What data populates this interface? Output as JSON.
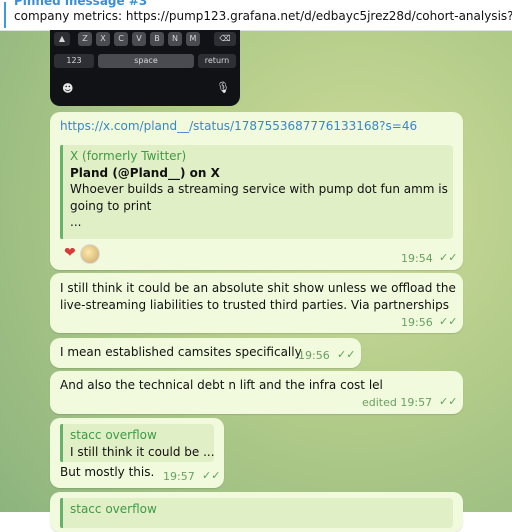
{
  "pinned": {
    "title": "Pinned message #3",
    "text": "company metrics: https://pump123.grafana.net/d/edbayc5jrez28d/cohort-analysis?orgId"
  },
  "keyboard": {
    "letters": [
      "Z",
      "X",
      "C",
      "V",
      "B",
      "N",
      "M"
    ],
    "numbers_label": "123",
    "space_label": "space",
    "return_label": "return"
  },
  "messages": {
    "link_post": {
      "url": "https://x.com/pland__/status/1787553687776133168?s=46",
      "preview_site": "X (formerly Twitter)",
      "preview_title": "Pland (@Pland__) on X",
      "preview_line1": "Whoever builds a streaming service with pump dot fun amm is",
      "preview_line2": "going to print",
      "preview_line3": "...",
      "time": "19:54"
    },
    "m1": {
      "line1": "I still think it could be an absolute shit show unless we offload the",
      "line2": "live-streaming liabilities to trusted third parties. Via partnerships",
      "time": "19:56"
    },
    "m2": {
      "text": "I mean established camsites specifically",
      "time": "19:56"
    },
    "m3": {
      "text": "And also the technical debt n lift and the infra cost lel",
      "time": "edited 19:57"
    },
    "m4": {
      "reply_name": "stacc overflow",
      "reply_text": "I still think it could be ...",
      "text": "But mostly this.",
      "time": "19:57"
    },
    "m5": {
      "reply_name": "stacc overflow"
    }
  },
  "colors": {
    "bubble": "#f1fadc",
    "accent_green": "#66b26a",
    "link": "#3a86c9",
    "pin_accent": "#3a9be0"
  }
}
